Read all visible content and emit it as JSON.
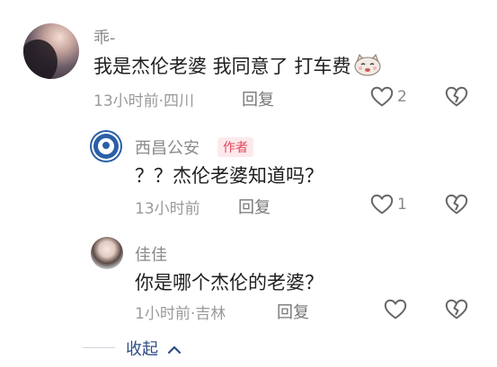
{
  "comments": [
    {
      "username": "乖-",
      "text": "我是杰伦老婆 我同意了 打车费",
      "meta": "13小时前·四川",
      "reply_label": "回复",
      "like_count": "2",
      "emoji": "cat-emoji"
    },
    {
      "username": "西昌公安",
      "badge": "作者",
      "text": "？？杰伦老婆知道吗？",
      "meta": "13小时前",
      "reply_label": "回复",
      "like_count": "1"
    },
    {
      "username": "佳佳",
      "text": "你是哪个杰伦的老婆？",
      "meta": "1小时前·吉林",
      "reply_label": "回复"
    }
  ],
  "collapse_label": "收起",
  "icons": {
    "like": "heart-outline-icon",
    "dislike": "broken-heart-icon",
    "collapse": "chevron-up-icon"
  },
  "colors": {
    "badge_text": "#e0475a",
    "badge_bg": "#fde9ec",
    "collapse_text": "#2d4e86"
  }
}
